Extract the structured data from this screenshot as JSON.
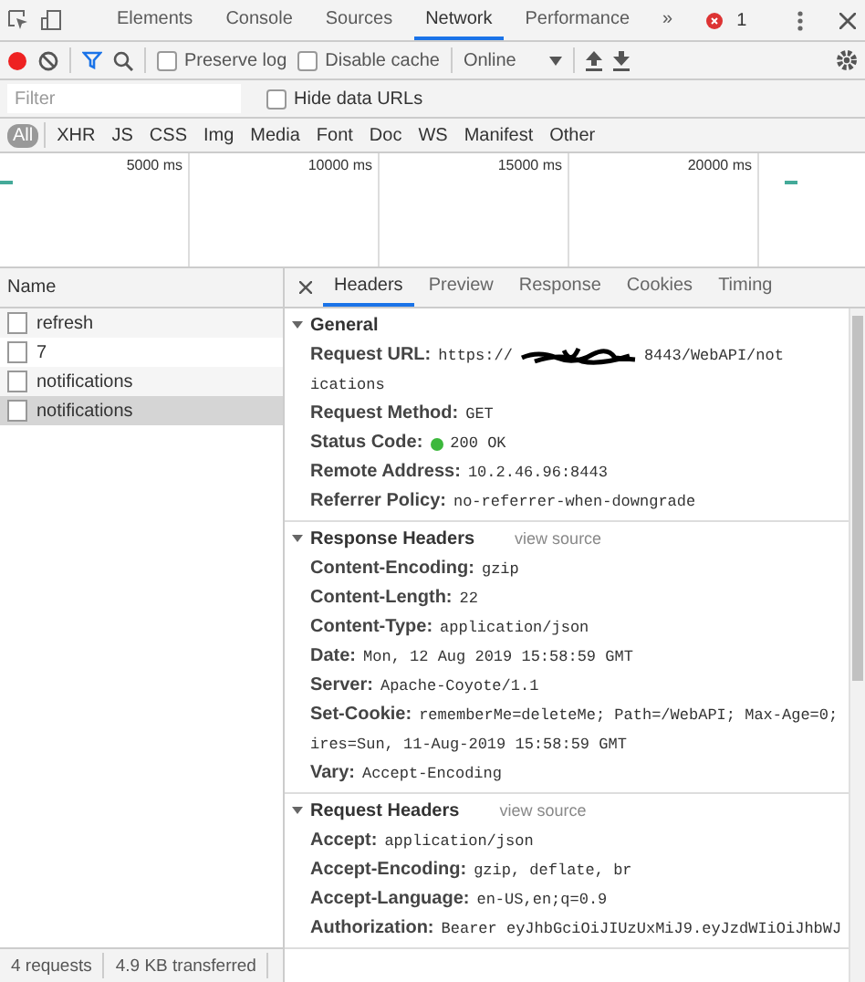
{
  "panel_tabs": [
    {
      "label": "Elements",
      "selected": false
    },
    {
      "label": "Console",
      "selected": false
    },
    {
      "label": "Sources",
      "selected": false
    },
    {
      "label": "Network",
      "selected": true
    },
    {
      "label": "Performance",
      "selected": false
    }
  ],
  "more_tabs": "»",
  "error_count": "1",
  "toolbar": {
    "recording": true,
    "preserve_log": {
      "label": "Preserve log",
      "checked": false
    },
    "disable_cache": {
      "label": "Disable cache",
      "checked": false
    },
    "throttling": "Online"
  },
  "filter": {
    "placeholder": "Filter",
    "hide_data_urls": {
      "label": "Hide data URLs",
      "checked": false
    }
  },
  "type_filters": [
    {
      "label": "All",
      "selected": true
    },
    {
      "label": "XHR",
      "selected": false
    },
    {
      "label": "JS",
      "selected": false
    },
    {
      "label": "CSS",
      "selected": false
    },
    {
      "label": "Img",
      "selected": false
    },
    {
      "label": "Media",
      "selected": false
    },
    {
      "label": "Font",
      "selected": false
    },
    {
      "label": "Doc",
      "selected": false
    },
    {
      "label": "WS",
      "selected": false
    },
    {
      "label": "Manifest",
      "selected": false
    },
    {
      "label": "Other",
      "selected": false
    }
  ],
  "timeline_ticks": [
    "5000 ms",
    "10000 ms",
    "15000 ms",
    "20000 ms"
  ],
  "requests": {
    "column": "Name",
    "items": [
      {
        "name": "refresh",
        "selected": false
      },
      {
        "name": "7",
        "selected": false
      },
      {
        "name": "notifications",
        "selected": false
      },
      {
        "name": "notifications",
        "selected": true
      }
    ]
  },
  "detail_tabs": [
    {
      "label": "Headers",
      "selected": true
    },
    {
      "label": "Preview",
      "selected": false
    },
    {
      "label": "Response",
      "selected": false
    },
    {
      "label": "Cookies",
      "selected": false
    },
    {
      "label": "Timing",
      "selected": false
    }
  ],
  "sections": [
    {
      "title": "General",
      "expanded": true,
      "rows": [
        {
          "kind": "redacted",
          "name": "Request URL:",
          "value": "https://",
          "value_end": "8443/WebAPI/not",
          "continuation": "ications"
        },
        {
          "kind": "plain",
          "name": "Request Method:",
          "value": "GET"
        },
        {
          "kind": "status",
          "name": "Status Code:",
          "value": "200 OK",
          "color": "#3cb83c"
        },
        {
          "kind": "plain",
          "name": "Remote Address:",
          "value": "10.2.46.96:8443"
        },
        {
          "kind": "plain",
          "name": "Referrer Policy:",
          "value": "no-referrer-when-downgrade"
        }
      ]
    },
    {
      "title": "Response Headers",
      "view_source": "view source",
      "expanded": true,
      "rows": [
        {
          "kind": "plain",
          "name": "Content-Encoding:",
          "value": "gzip"
        },
        {
          "kind": "plain",
          "name": "Content-Length:",
          "value": "22"
        },
        {
          "kind": "plain",
          "name": "Content-Type:",
          "value": "application/json"
        },
        {
          "kind": "plain",
          "name": "Date:",
          "value": "Mon, 12 Aug 2019 15:58:59 GMT"
        },
        {
          "kind": "plain",
          "name": "Server:",
          "value": "Apache-Coyote/1.1"
        },
        {
          "kind": "plain",
          "name": "Set-Cookie:",
          "value": "rememberMe=deleteMe; Path=/WebAPI; Max-Age=0;",
          "continuation": "ires=Sun, 11-Aug-2019 15:58:59 GMT"
        },
        {
          "kind": "plain",
          "name": "Vary:",
          "value": "Accept-Encoding"
        }
      ]
    },
    {
      "title": "Request Headers",
      "view_source": "view source",
      "expanded": true,
      "rows": [
        {
          "kind": "plain",
          "name": "Accept:",
          "value": "application/json"
        },
        {
          "kind": "plain",
          "name": "Accept-Encoding:",
          "value": "gzip, deflate, br"
        },
        {
          "kind": "plain",
          "name": "Accept-Language:",
          "value": "en-US,en;q=0.9"
        },
        {
          "kind": "plain",
          "name": "Authorization:",
          "value": "Bearer eyJhbGciOiJIUzUxMiJ9.eyJzdWIiOiJhbWJ"
        }
      ]
    }
  ],
  "status_bar": [
    "4 requests",
    "4.9 KB transferred"
  ]
}
